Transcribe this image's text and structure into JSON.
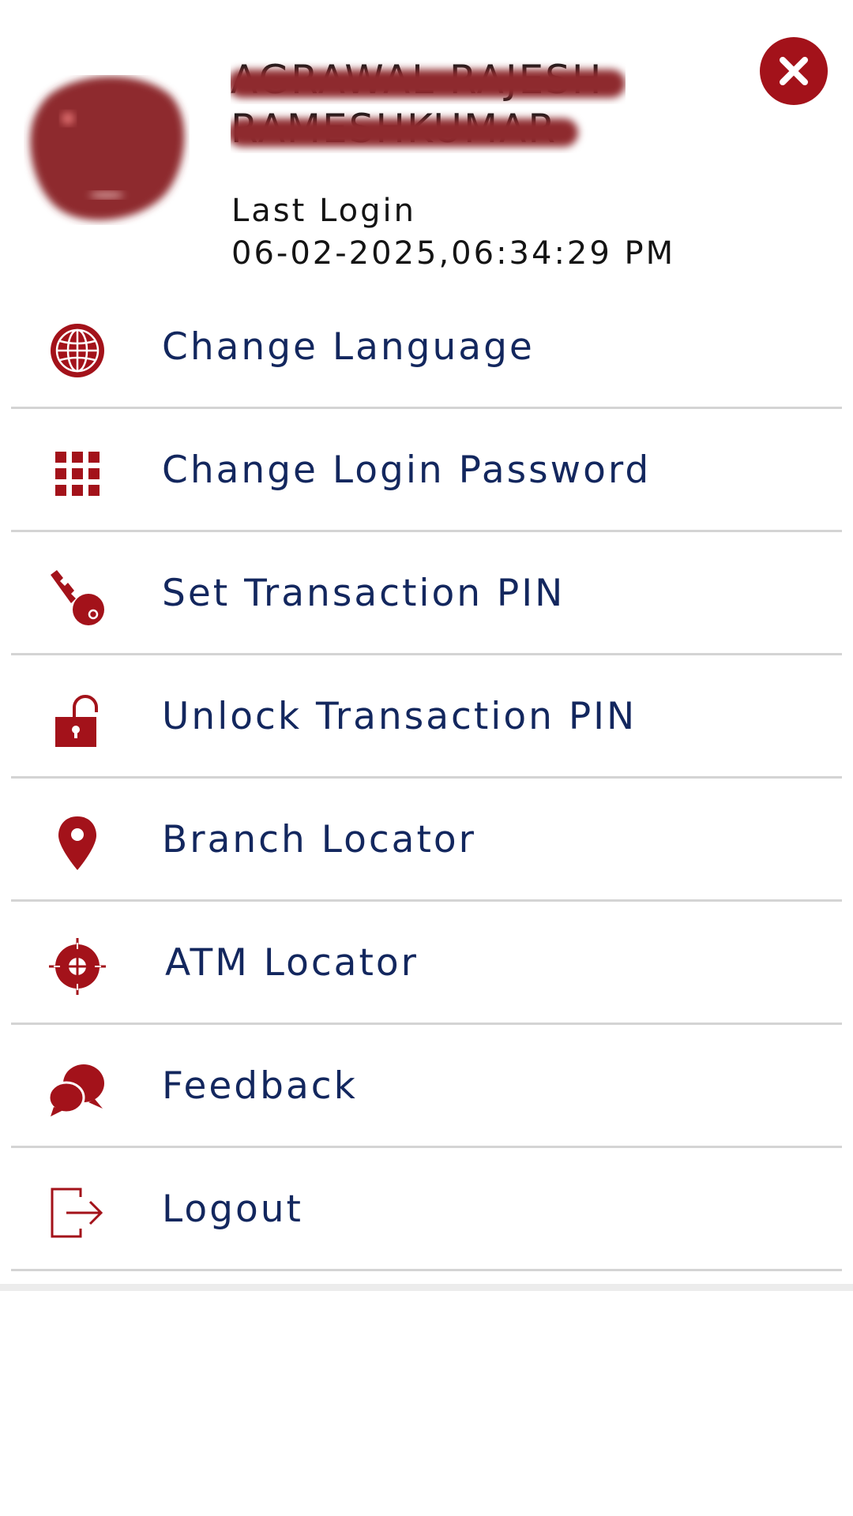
{
  "profile": {
    "name_line1": "AGRAWAL RAJESH",
    "name_line2": "RAMESHKUMAR",
    "last_login_label": "Last Login",
    "last_login_value": "06-02-2025,06:34:29 PM"
  },
  "colors": {
    "accent": "#a3121a",
    "text_primary": "#13275e",
    "divider": "#d4d4d4"
  },
  "menu": {
    "items": [
      {
        "label": "Change Language",
        "icon": "globe-icon"
      },
      {
        "label": "Change Login Password",
        "icon": "keypad-grid-icon"
      },
      {
        "label": "Set Transaction PIN",
        "icon": "key-icon"
      },
      {
        "label": "Unlock Transaction PIN",
        "icon": "unlock-padlock-icon"
      },
      {
        "label": "Branch Locator",
        "icon": "map-pin-icon"
      },
      {
        "label": "ATM Locator",
        "icon": "crosshair-target-icon"
      },
      {
        "label": "Feedback",
        "icon": "chat-bubbles-icon"
      },
      {
        "label": "Logout",
        "icon": "logout-icon"
      }
    ]
  }
}
